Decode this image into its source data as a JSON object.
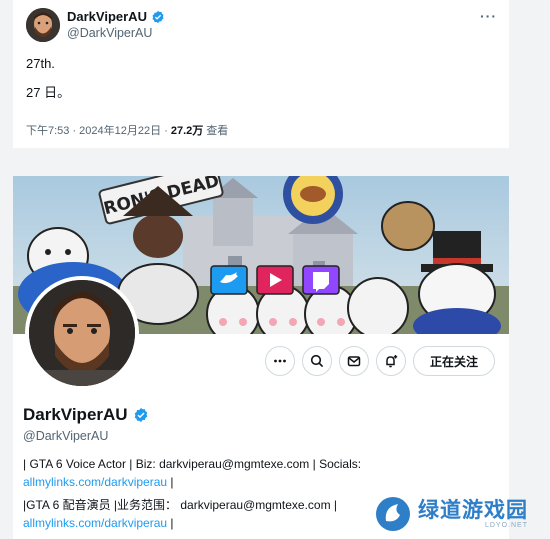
{
  "tweet": {
    "display_name": "DarkViperAU",
    "handle": "@DarkViperAU",
    "more_icon": "more-horizontal-icon",
    "text_line1": "27th.",
    "text_line2": "27 日。",
    "time": "下午7:53 · 2024年12月22日 ·",
    "views_count": "27.2万",
    "views_label": "查看"
  },
  "profile": {
    "display_name": "DarkViperAU",
    "handle": "@DarkViperAU",
    "follow_label": "正在关注",
    "actions": [
      "more-horizontal-icon",
      "search-icon",
      "message-icon",
      "notify-plus-icon"
    ],
    "bio_en_prefix": "| GTA 6 Voice Actor | Biz: darkviperau@mgmtexe.com | Socials:",
    "bio_en_link": "allmylinks.com/darkviperau",
    "bio_en_suffix": " |",
    "bio_zh_prefix": "|GTA 6 配音演员 |业务范围： darkviperau@mgmtexe.com |",
    "bio_zh_link": "allmylinks.com/darkviperau",
    "bio_zh_suffix": " |"
  },
  "banner": {
    "sign_text": "RON'S DEAD"
  },
  "watermark": {
    "title": "绿道游戏园",
    "url": "LDYO.NET"
  },
  "colors": {
    "verified": "#1d9bf0",
    "link": "#1d9bf0",
    "secondary_text": "#536471",
    "twitter_sign": "#1d9bf0",
    "youtube_sign": "#e0245e",
    "twitch_sign": "#9146ff"
  }
}
